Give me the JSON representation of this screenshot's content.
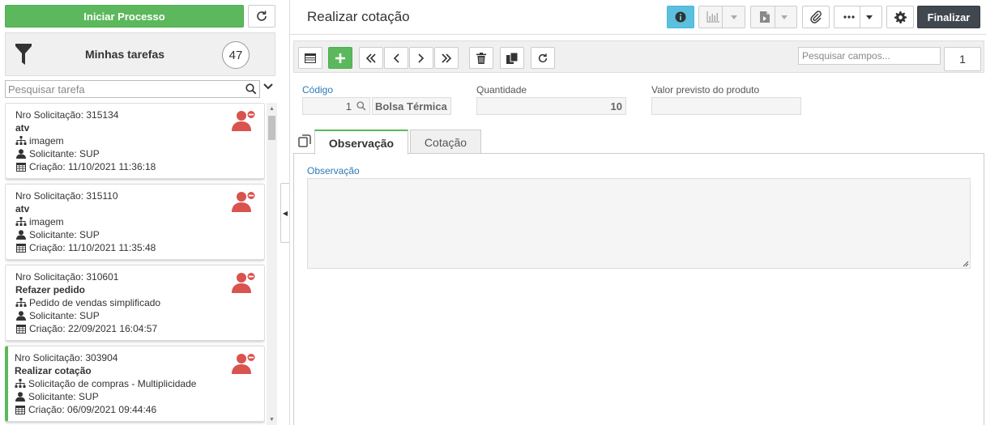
{
  "left": {
    "start_button": "Iniciar Processo",
    "my_tasks": {
      "title": "Minhas tarefas",
      "count": "47"
    },
    "search": {
      "placeholder": "Pesquisar tarefa"
    },
    "tasks": [
      {
        "request": "Nro Solicitação: 315134",
        "name": "atv",
        "process": "imagem",
        "requester": "Solicitante:  SUP",
        "created": "Criação: 11/10/2021 11:36:18"
      },
      {
        "request": "Nro Solicitação: 315110",
        "name": "atv",
        "process": "imagem",
        "requester": "Solicitante:  SUP",
        "created": "Criação: 11/10/2021 11:35:48"
      },
      {
        "request": "Nro Solicitação: 310601",
        "name": "Refazer pedido",
        "process": "Pedido de vendas simplificado",
        "requester": "Solicitante:  SUP",
        "created": "Criação: 22/09/2021 16:04:57"
      },
      {
        "request": "Nro Solicitação: 303904",
        "name": "Realizar cotação",
        "process": "Solicitação de compras - Multiplicidade",
        "requester": "Solicitante:  SUP",
        "created": "Criação: 06/09/2021 09:44:46"
      }
    ]
  },
  "header": {
    "title": "Realizar cotação",
    "finish_button": "Finalizar"
  },
  "toolbar": {
    "search_placeholder": "Pesquisar campos...",
    "page": "1"
  },
  "form": {
    "codigo_label": "Código",
    "codigo_value": "1",
    "product_value": "Bolsa Térmica",
    "quantidade_label": "Quantidade",
    "quantidade_value": "10",
    "valor_label": "Valor previsto do produto",
    "valor_value": ""
  },
  "tabs": [
    {
      "label": "Observação",
      "active": true
    },
    {
      "label": "Cotação",
      "active": false
    }
  ],
  "observacao": {
    "label": "Observação",
    "value": ""
  },
  "colors": {
    "green": "#5cb85c",
    "info": "#5bc0de",
    "dark": "#40474f",
    "alert_red": "#d9534f"
  }
}
